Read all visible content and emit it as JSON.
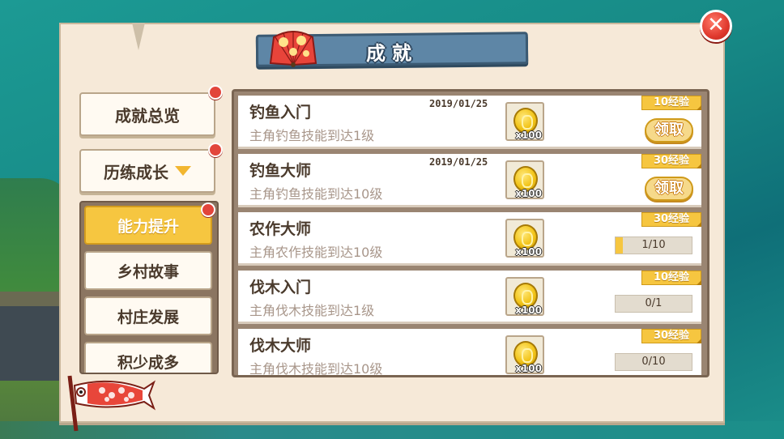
{
  "window": {
    "title": "成就",
    "close_label": "✕"
  },
  "menu": {
    "overview_label": "成就总览",
    "growth_label": "历练成长",
    "sub_items": [
      {
        "label": "能力提升",
        "active": true
      },
      {
        "label": "乡村故事",
        "active": false
      },
      {
        "label": "村庄发展",
        "active": false
      },
      {
        "label": "积少成多",
        "active": false
      }
    ]
  },
  "achievements": [
    {
      "title": "钓鱼入门",
      "desc": "主角钓鱼技能到达1级",
      "date": "2019/01/25",
      "reward_qty": "x100",
      "exp": "10经验",
      "action": "领取",
      "progress": null
    },
    {
      "title": "钓鱼大师",
      "desc": "主角钓鱼技能到达10级",
      "date": "2019/01/25",
      "reward_qty": "x100",
      "exp": "30经验",
      "action": "领取",
      "progress": null
    },
    {
      "title": "农作大师",
      "desc": "主角农作技能到达10级",
      "date": "",
      "reward_qty": "x100",
      "exp": "30经验",
      "action": "",
      "progress": {
        "text": "1/10",
        "fraction": 0.1
      }
    },
    {
      "title": "伐木入门",
      "desc": "主角伐木技能到达1级",
      "date": "",
      "reward_qty": "x100",
      "exp": "10经验",
      "action": "",
      "progress": {
        "text": "0/1",
        "fraction": 0
      }
    },
    {
      "title": "伐木大师",
      "desc": "主角伐木技能到达10级",
      "date": "",
      "reward_qty": "x100",
      "exp": "30经验",
      "action": "",
      "progress": {
        "text": "0/10",
        "fraction": 0
      }
    }
  ],
  "colors": {
    "accent_yellow": "#f6c640",
    "badge_red": "#e2453b",
    "title_blue": "#5e86a6",
    "parchment": "#f6e9d8"
  },
  "icons": {
    "title_decoration": "folding-fan-icon",
    "reward": "gold-coin-icon",
    "corner_decoration": "koinobori-carp-flag-icon"
  }
}
